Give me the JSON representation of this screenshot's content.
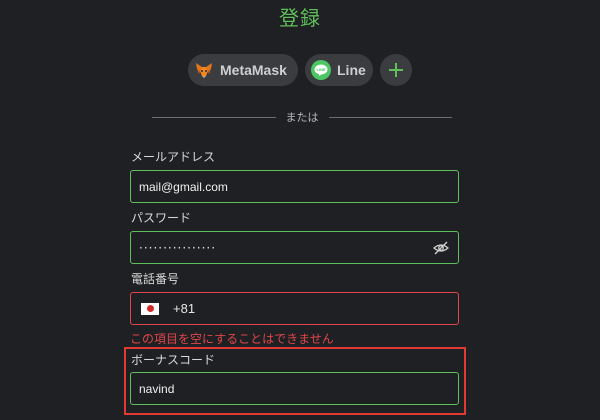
{
  "page": {
    "title": "登録"
  },
  "social": {
    "metamask_label": "MetaMask",
    "line_label": "Line",
    "add_icon": "plus-icon"
  },
  "divider": {
    "text": "または"
  },
  "email": {
    "label": "メールアドレス",
    "value": "mail@gmail.com"
  },
  "password": {
    "label": "パスワード",
    "masked_value": "················",
    "toggle_icon": "eye-slash-icon"
  },
  "phone": {
    "label": "電話番号",
    "country_flag": "japan-flag",
    "dial_code": "+81",
    "error": "この項目を空にすることはできません"
  },
  "bonus": {
    "label": "ボーナスコード",
    "value": "navind"
  },
  "colors": {
    "accent_green": "#5fbf5a",
    "error_red": "#e0454a",
    "highlight_red": "#e13a32",
    "background": "#1f2023"
  }
}
